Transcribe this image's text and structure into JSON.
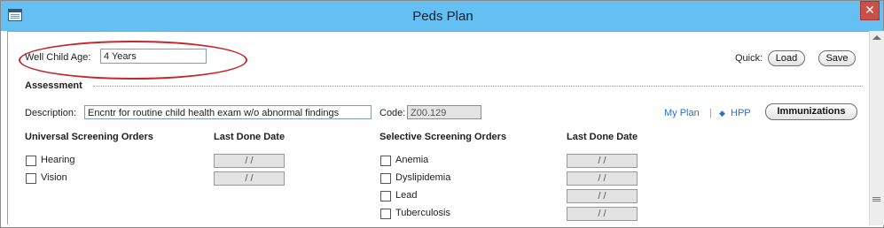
{
  "window": {
    "title": "Peds Plan"
  },
  "well_child": {
    "label": "Well Child Age:",
    "value": "4 Years"
  },
  "quick": {
    "label": "Quick:",
    "load": "Load",
    "save": "Save"
  },
  "assessment": {
    "section_title": "Assessment",
    "description_label": "Description:",
    "description_value": "Encntr for routine child health exam w/o abnormal findings",
    "code_label": "Code:",
    "code_value": "Z00.129"
  },
  "links": {
    "my_plan": "My Plan",
    "separator": "|",
    "hpp_icon": "◆",
    "hpp": "HPP",
    "immunizations": "Immunizations"
  },
  "universal": {
    "header": "Universal Screening Orders",
    "date_header": "Last Done Date",
    "items": [
      {
        "label": "Hearing",
        "date": "/ /"
      },
      {
        "label": "Vision",
        "date": "/ /"
      }
    ]
  },
  "selective": {
    "header": "Selective Screening Orders",
    "date_header": "Last Done Date",
    "items": [
      {
        "label": "Anemia",
        "date": "/ /"
      },
      {
        "label": "Dyslipidemia",
        "date": "/ /"
      },
      {
        "label": "Lead",
        "date": "/ /"
      },
      {
        "label": "Tuberculosis",
        "date": "/ /"
      }
    ]
  },
  "colors": {
    "titlebar": "#64bff2",
    "close": "#c85048",
    "highlight": "#c4282c",
    "link": "#2a6ed6"
  }
}
